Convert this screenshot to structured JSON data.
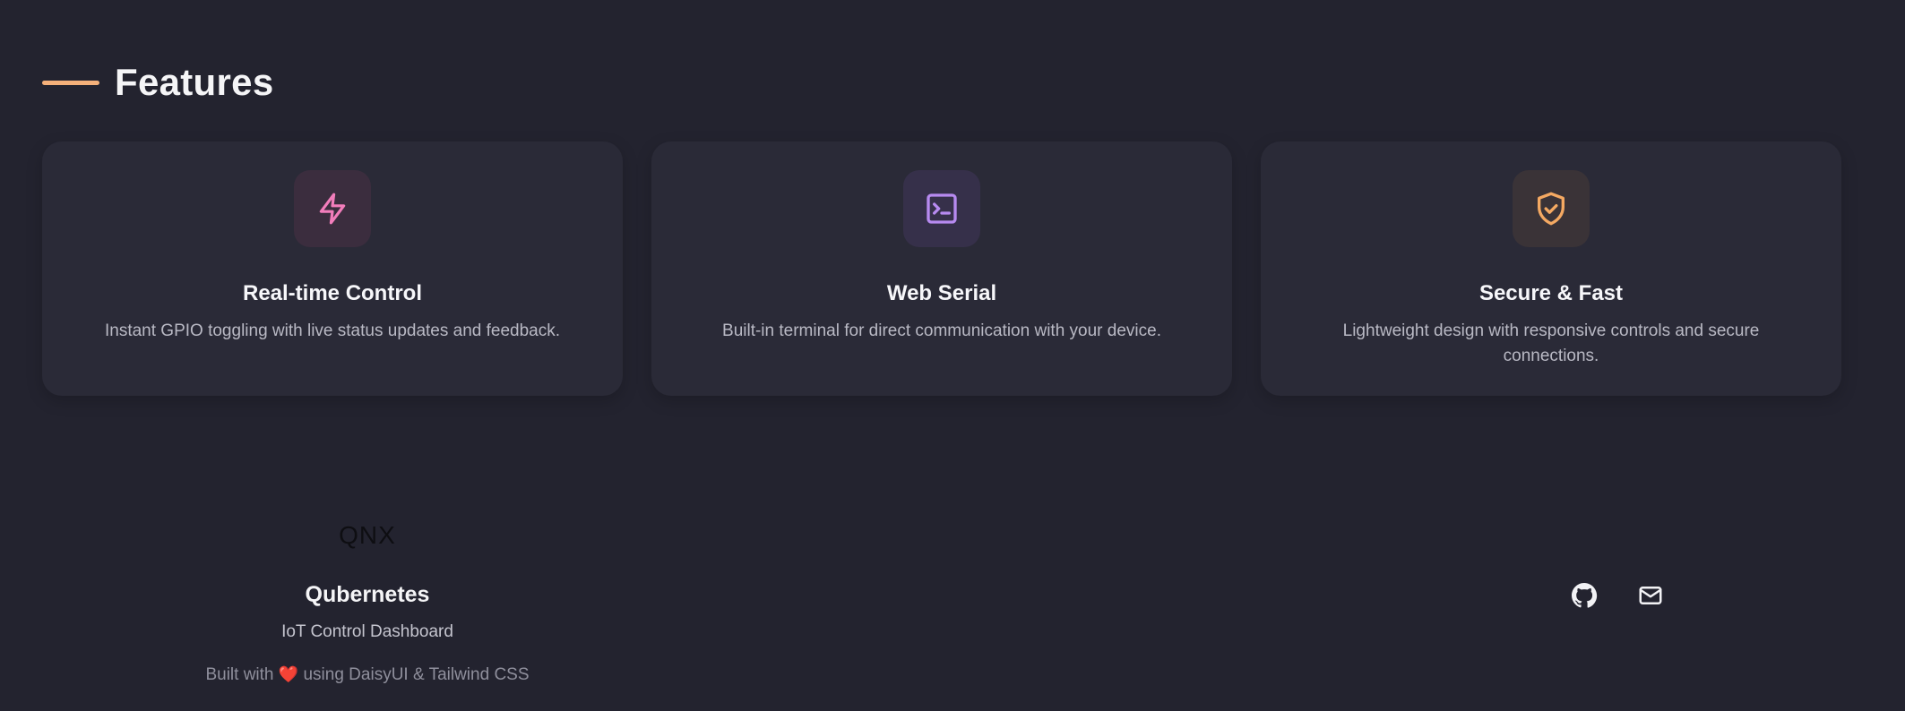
{
  "features": {
    "title": "Features",
    "accent_color": "#f4b07a",
    "cards": [
      {
        "icon": "lightning-bolt-icon",
        "icon_color": "#f27dbb",
        "icon_bg": "#3b2d3e",
        "title": "Real-time Control",
        "description": "Instant GPIO toggling with live status updates and feedback."
      },
      {
        "icon": "terminal-icon",
        "icon_color": "#b78af0",
        "icon_bg": "#36304a",
        "title": "Web Serial",
        "description": "Built-in terminal for direct communication with your device."
      },
      {
        "icon": "shield-check-icon",
        "icon_color": "#f4a962",
        "icon_bg": "#3a3337",
        "title": "Secure & Fast",
        "description": "Lightweight design with responsive controls and secure connections."
      }
    ]
  },
  "footer": {
    "logo_text": "QNX",
    "brand_name": "Qubernetes",
    "tagline": "IoT Control Dashboard",
    "credit_prefix": "Built with",
    "credit_heart": "❤️",
    "credit_suffix": "using DaisyUI & Tailwind CSS",
    "social": [
      {
        "icon": "github-icon"
      },
      {
        "icon": "mail-icon"
      }
    ]
  }
}
